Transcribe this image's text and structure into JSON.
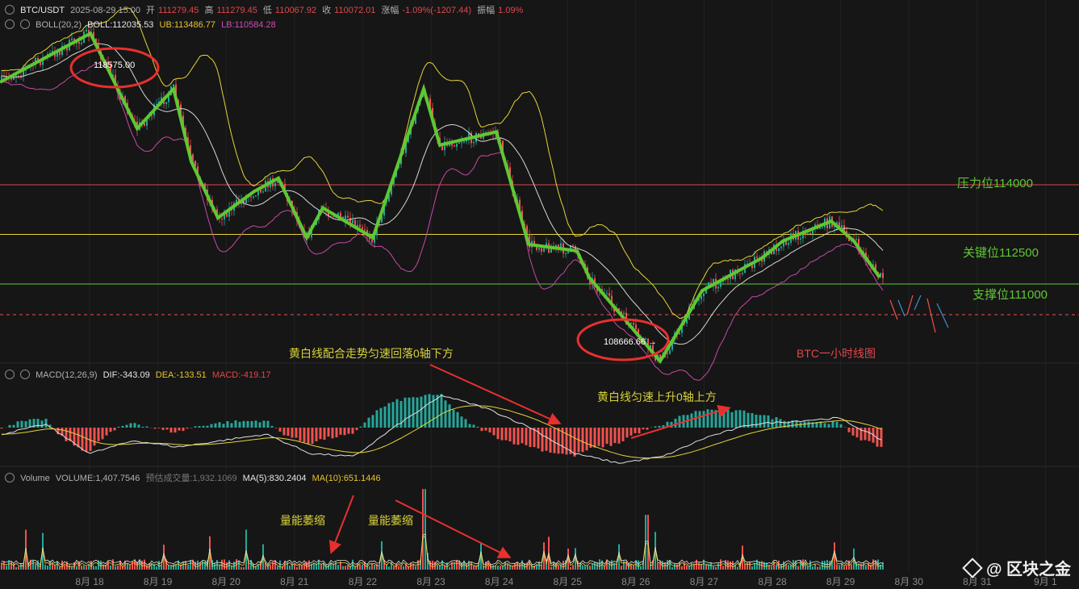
{
  "header": {
    "symbol": "BTC/USDT",
    "datetime": "2025-08-29 15:00",
    "open_label": "开",
    "open": "111279.45",
    "high_label": "高",
    "high": "111279.45",
    "low_label": "低",
    "low": "110067.92",
    "close_label": "收",
    "close": "110072.01",
    "change_label": "涨幅",
    "change": "-1.09%(-1207.44)",
    "amp_label": "振幅",
    "amp": "1.09%"
  },
  "boll": {
    "name": "BOLL(20,2)",
    "boll": "BOLL:112035.53",
    "ub": "UB:113486.77",
    "lb": "LB:110584.28"
  },
  "macd_header": {
    "name": "MACD(12,26,9)",
    "dif": "DIF:-343.09",
    "dea": "DEA:-133.51",
    "macd": "MACD:-419.17"
  },
  "volume_header": {
    "name": "Volume",
    "volume": "VOLUME:1,407.7546",
    "est": "预估成交量:1,932.1069",
    "ma5": "MA(5):830.2404",
    "ma10": "MA(10):651.1446"
  },
  "annotations": {
    "high_point": "118575.00",
    "low_point": "108666.66",
    "resistance": "压力位114000",
    "key": "关键位112500",
    "support": "支撑位111000",
    "caption": "BTC一小时线图",
    "macd_note1": "黄白线配合走势匀速回落0轴下方",
    "macd_note2": "黄白线匀速上升0轴上方",
    "vol_note1": "量能萎缩",
    "vol_note2": "量能萎缩"
  },
  "watermark": "@ 区块之金",
  "colors": {
    "up": "#26a69a",
    "down": "#ef5350",
    "trend": "#5ec832",
    "boll_up": "#e6d33a",
    "boll_mid": "#d6d6d6",
    "boll_low": "#c64aa8",
    "resistance": "#e0474c",
    "key": "#e6d33a",
    "support": "#5ec832",
    "oval": "#e8302e",
    "arrow": "#e8302e"
  },
  "chart_data": {
    "type": "line",
    "x_ticks": [
      "8月 18",
      "8月 19",
      "8月 20",
      "8月 21",
      "8月 22",
      "8月 23",
      "8月 24",
      "8月 25",
      "8月 26",
      "8月 27",
      "8月 28",
      "8月 29",
      "8月 30",
      "8月 31",
      "9月 1"
    ],
    "price_levels": {
      "resistance": 114000,
      "key": 112500,
      "support": 111000,
      "last_close": 110072.01
    },
    "trend_path_dates": [
      "8-17 12h",
      "8-18",
      "8-18 12h",
      "8-19",
      "8-19 12h",
      "8-20",
      "8-20 12h",
      "8-21",
      "8-21 12h",
      "8-22",
      "8-22 12h",
      "8-23",
      "8-23 12h",
      "8-24",
      "8-24 12h",
      "8-25",
      "8-25 12h",
      "8-26",
      "8-26 12h",
      "8-27",
      "8-27 12h",
      "8-28",
      "8-28 12h",
      "8-29",
      "8-29 12h"
    ],
    "trend_path": [
      117100,
      118575,
      115700,
      116900,
      114700,
      113000,
      113800,
      114200,
      112400,
      113300,
      112400,
      116900,
      115200,
      115600,
      112200,
      112000,
      111200,
      108666,
      110300,
      110800,
      111800,
      112300,
      112900,
      112300,
      111200
    ],
    "macd_dif_approx": [
      -20,
      10,
      -80,
      -40,
      -60,
      -40,
      -20,
      -80,
      -90,
      10,
      100,
      60,
      0,
      -80,
      -110,
      -90,
      -30,
      10,
      20,
      30,
      -40
    ],
    "volume_approx": {
      "max_bar": 5000,
      "spikes": [
        "8-23",
        "8-25",
        "8-26"
      ]
    }
  }
}
